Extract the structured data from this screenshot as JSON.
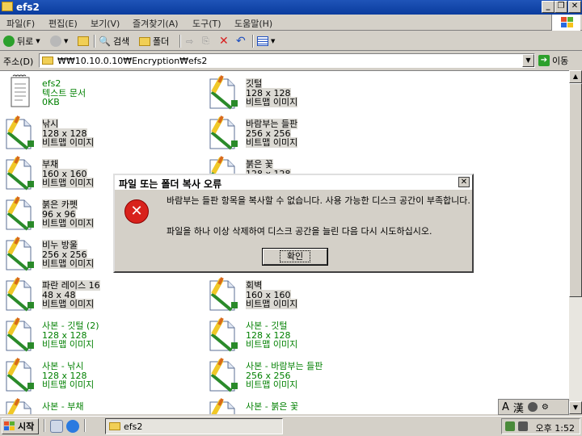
{
  "window": {
    "title": "efs2"
  },
  "menu": [
    "파일(F)",
    "편집(E)",
    "보기(V)",
    "즐겨찾기(A)",
    "도구(T)",
    "도움말(H)"
  ],
  "toolbar": {
    "back": "뒤로",
    "search": "검색",
    "folders": "폴더"
  },
  "address": {
    "label": "주소(D)",
    "value": "₩₩10.10.0.10₩Encryption₩efs2",
    "go": "이동"
  },
  "files": [
    {
      "name": "efs2",
      "l2": "텍스트 문서",
      "l3": "0KB",
      "kind": "text",
      "green": true,
      "sel": false
    },
    {
      "name": "깃털",
      "l2": "128 x 128",
      "l3": "비트맵 이미지",
      "kind": "bmp",
      "green": false,
      "sel": true
    },
    {
      "name": "낚시",
      "l2": "128 x 128",
      "l3": "비트맵 이미지",
      "kind": "bmp",
      "green": false,
      "sel": true
    },
    {
      "name": "바람부는 들판",
      "l2": "256 x 256",
      "l3": "비트맵 이미지",
      "kind": "bmp",
      "green": false,
      "sel": true
    },
    {
      "name": "부채",
      "l2": "160 x 160",
      "l3": "비트맵 이미지",
      "kind": "bmp",
      "green": false,
      "sel": true
    },
    {
      "name": "붉은 꽃",
      "l2": "128 x 128",
      "l3": "",
      "kind": "bmp",
      "green": false,
      "sel": true
    },
    {
      "name": "붉은 카펫",
      "l2": "96 x 96",
      "l3": "비트맵 이미지",
      "kind": "bmp",
      "green": false,
      "sel": true
    },
    {
      "name": "",
      "l2": "",
      "l3": "",
      "kind": "none",
      "green": false,
      "sel": false
    },
    {
      "name": "비누 방울",
      "l2": "256 x 256",
      "l3": "비트맵 이미지",
      "kind": "bmp",
      "green": false,
      "sel": true
    },
    {
      "name": "",
      "l2": "",
      "l3": "",
      "kind": "none",
      "green": false,
      "sel": false
    },
    {
      "name": "파란 레이스 16",
      "l2": "48 x 48",
      "l3": "비트맵 이미지",
      "kind": "bmp",
      "green": false,
      "sel": true
    },
    {
      "name": "회벽",
      "l2": "160 x 160",
      "l3": "비트맵 이미지",
      "kind": "bmp",
      "green": false,
      "sel": true
    },
    {
      "name": "사본 - 깃털 (2)",
      "l2": "128 x 128",
      "l3": "비트맵 이미지",
      "kind": "bmp",
      "green": true,
      "sel": false
    },
    {
      "name": "사본 - 깃털",
      "l2": "128 x 128",
      "l3": "비트맵 이미지",
      "kind": "bmp",
      "green": true,
      "sel": false
    },
    {
      "name": "사본 - 낚시",
      "l2": "128 x 128",
      "l3": "비트맵 이미지",
      "kind": "bmp",
      "green": true,
      "sel": false
    },
    {
      "name": "사본 - 바람부는 들판",
      "l2": "256 x 256",
      "l3": "비트맵 이미지",
      "kind": "bmp",
      "green": true,
      "sel": false
    },
    {
      "name": "사본 - 부채",
      "l2": "",
      "l3": "",
      "kind": "bmp",
      "green": true,
      "sel": false
    },
    {
      "name": "사본 - 붉은 꽃",
      "l2": "",
      "l3": "",
      "kind": "bmp",
      "green": true,
      "sel": false
    }
  ],
  "dialog": {
    "title": "파일 또는 폴더 복사 오류",
    "message": "바람부는 들판 항목을 복사할 수 없습니다. 사용 가능한 디스크 공간이 부족합니다.",
    "hint": "파일을 하나 이상 삭제하여 디스크 공간을 늘린 다음 다시 시도하십시오.",
    "ok": "확인"
  },
  "taskbar": {
    "start": "시작",
    "task": "efs2",
    "clock": "오후 1:52"
  },
  "ime": {
    "a": "A",
    "han": "漢"
  },
  "colors": {
    "titlebar": "#0a3c9e",
    "green_text": "#008000",
    "error": "#d8221c"
  }
}
